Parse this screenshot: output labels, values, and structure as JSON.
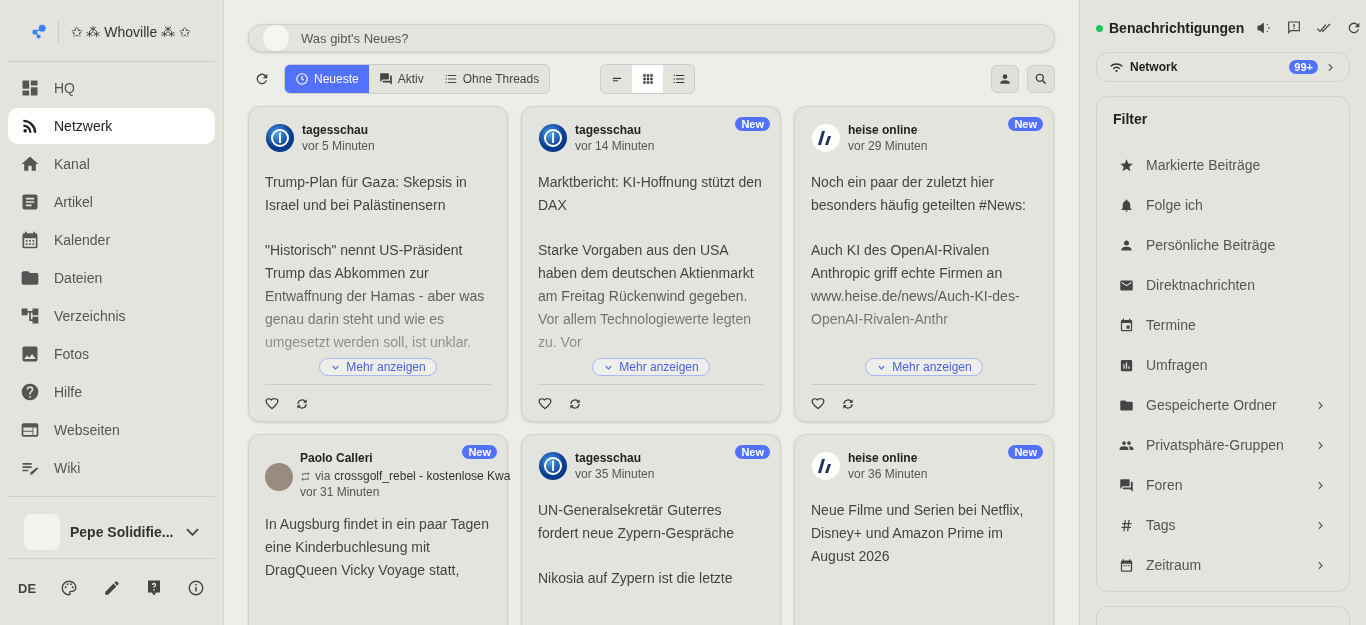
{
  "site": {
    "name": "✩ ⁂ Whoville ⁂ ✩"
  },
  "nav": [
    {
      "label": "HQ",
      "selected": false
    },
    {
      "label": "Netzwerk",
      "selected": true
    },
    {
      "label": "Kanal",
      "selected": false
    },
    {
      "label": "Artikel",
      "selected": false
    },
    {
      "label": "Kalender",
      "selected": false
    },
    {
      "label": "Dateien",
      "selected": false
    },
    {
      "label": "Verzeichnis",
      "selected": false
    },
    {
      "label": "Fotos",
      "selected": false
    },
    {
      "label": "Hilfe",
      "selected": false
    },
    {
      "label": "Webseiten",
      "selected": false
    },
    {
      "label": "Wiki",
      "selected": false
    }
  ],
  "user": {
    "name": "Pepe Solidifie..."
  },
  "footer": {
    "language": "DE"
  },
  "composer": {
    "placeholder": "Was gibt's Neues?"
  },
  "tabs": [
    {
      "label": "Neueste",
      "selected": true
    },
    {
      "label": "Aktiv",
      "selected": false
    },
    {
      "label": "Ohne Threads",
      "selected": false
    }
  ],
  "views": [
    {
      "selected": false
    },
    {
      "selected": true
    },
    {
      "selected": false
    }
  ],
  "posts": [
    {
      "author": "tagesschau",
      "kind": "globe",
      "time": "vor 5 Minuten",
      "paragraphs": [
        "Trump-Plan für Gaza: Skepsis in Israel und bei Palästinensern",
        "\"Historisch\" nennt US-Präsident Trump das Abkommen zur Entwaffnung der Hamas - aber was genau darin steht und wie es umgesetzt werden soll, ist unklar."
      ],
      "more": "Mehr anzeigen"
    },
    {
      "author": "tagesschau",
      "kind": "globe",
      "time": "vor 14 Minuten",
      "badge": "New",
      "paragraphs": [
        "Marktbericht: KI-Hoffnung stützt den DAX",
        "Starke Vorgaben aus den USA haben dem deutschen Aktienmarkt am Freitag Rückenwind gegeben. Vor allem Technologiewerte legten zu. Vor"
      ],
      "more": "Mehr anzeigen"
    },
    {
      "author": "heise online",
      "kind": "slash",
      "time": "vor 29 Minuten",
      "badge": "New",
      "paragraphs": [
        "Noch ein paar der zuletzt hier besonders häufig geteilten #News:",
        "Auch KI des OpenAI-Rivalen Anthropic griff echte Firmen an www.heise.de/news/Auch-KI-des-OpenAI-Rivalen-Anthr"
      ],
      "more": "Mehr anzeigen"
    },
    {
      "author": "Paolo Calleri",
      "kind": "photo",
      "time": "vor 31 Minuten",
      "badge": "New",
      "via": "crossgolf_rebel - kostenlose Kwa",
      "via_label": "via",
      "paragraphs": [
        "In Augsburg findet in ein paar Tagen eine Kinderbuchlesung mit DragQueen Vicky Voyage statt,"
      ]
    },
    {
      "author": "tagesschau",
      "kind": "globe",
      "time": "vor 35 Minuten",
      "badge": "New",
      "paragraphs": [
        "UN-Generalsekretär Guterres fordert neue Zypern-Gespräche",
        "Nikosia auf Zypern ist die letzte"
      ]
    },
    {
      "author": "heise online",
      "kind": "slash",
      "time": "vor 36 Minuten",
      "badge": "New",
      "paragraphs": [
        "Neue Filme und Serien bei Netflix, Disney+ und Amazon Prime im August 2026"
      ]
    }
  ],
  "notifications": {
    "title": "Benachrichtigungen",
    "online": true,
    "network": {
      "label": "Network",
      "count": "99+"
    }
  },
  "filter": {
    "title": "Filter",
    "items": [
      {
        "label": "Markierte Beiträge",
        "kind": "link"
      },
      {
        "label": "Folge ich",
        "kind": "link"
      },
      {
        "label": "Persönliche Beiträge",
        "kind": "link"
      },
      {
        "label": "Direktnachrichten",
        "kind": "link"
      },
      {
        "label": "Termine",
        "kind": "link"
      },
      {
        "label": "Umfragen",
        "kind": "link"
      },
      {
        "label": "Gespeicherte Ordner",
        "kind": "submenu"
      },
      {
        "label": "Privatsphäre-Gruppen",
        "kind": "submenu"
      },
      {
        "label": "Foren",
        "kind": "submenu"
      },
      {
        "label": "Tags",
        "kind": "submenu"
      },
      {
        "label": "Zeitraum",
        "kind": "submenu"
      }
    ]
  }
}
